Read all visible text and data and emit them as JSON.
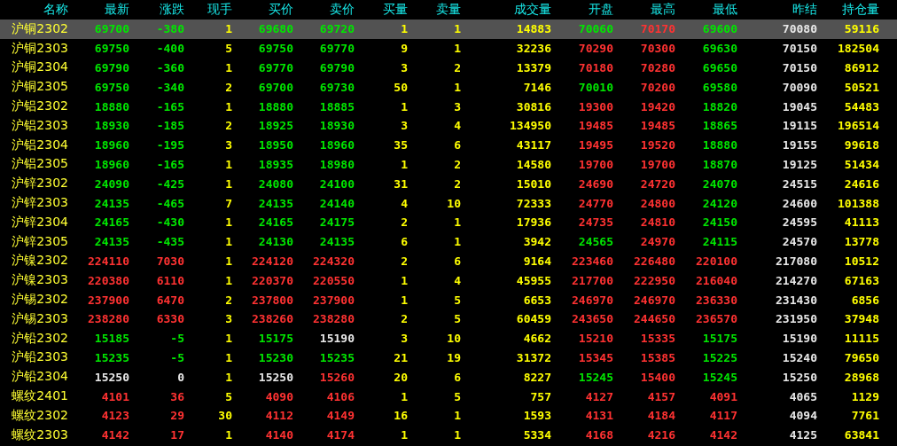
{
  "columns": [
    "名称",
    "最新",
    "涨跌",
    "现手",
    "买价",
    "卖价",
    "买量",
    "卖量",
    "成交量",
    "开盘",
    "最高",
    "最低",
    "昨结",
    "持仓量"
  ],
  "rows": [
    {
      "name": "沪铜2302",
      "selected": true,
      "last": {
        "text": "69700",
        "color": "#00e600"
      },
      "change": {
        "text": "-380",
        "color": "#00e600"
      },
      "lot": "1",
      "bid": {
        "text": "69680",
        "color": "#00e600"
      },
      "ask": {
        "text": "69720",
        "color": "#00e600"
      },
      "bid_qty": "1",
      "ask_qty": "1",
      "volume": "14883",
      "open": {
        "text": "70060",
        "color": "#00e600"
      },
      "high": {
        "text": "70170",
        "color": "#ff3232"
      },
      "low": {
        "text": "69600",
        "color": "#00e600"
      },
      "prev_settle": "70080",
      "open_interest": "59116"
    },
    {
      "name": "沪铜2303",
      "selected": false,
      "last": {
        "text": "69750",
        "color": "#00e600"
      },
      "change": {
        "text": "-400",
        "color": "#00e600"
      },
      "lot": "5",
      "bid": {
        "text": "69750",
        "color": "#00e600"
      },
      "ask": {
        "text": "69770",
        "color": "#00e600"
      },
      "bid_qty": "9",
      "ask_qty": "1",
      "volume": "32236",
      "open": {
        "text": "70290",
        "color": "#ff3232"
      },
      "high": {
        "text": "70300",
        "color": "#ff3232"
      },
      "low": {
        "text": "69630",
        "color": "#00e600"
      },
      "prev_settle": "70150",
      "open_interest": "182504"
    },
    {
      "name": "沪铜2304",
      "selected": false,
      "last": {
        "text": "69790",
        "color": "#00e600"
      },
      "change": {
        "text": "-360",
        "color": "#00e600"
      },
      "lot": "1",
      "bid": {
        "text": "69770",
        "color": "#00e600"
      },
      "ask": {
        "text": "69790",
        "color": "#00e600"
      },
      "bid_qty": "3",
      "ask_qty": "2",
      "volume": "13379",
      "open": {
        "text": "70180",
        "color": "#ff3232"
      },
      "high": {
        "text": "70280",
        "color": "#ff3232"
      },
      "low": {
        "text": "69650",
        "color": "#00e600"
      },
      "prev_settle": "70150",
      "open_interest": "86912"
    },
    {
      "name": "沪铜2305",
      "selected": false,
      "last": {
        "text": "69750",
        "color": "#00e600"
      },
      "change": {
        "text": "-340",
        "color": "#00e600"
      },
      "lot": "2",
      "bid": {
        "text": "69700",
        "color": "#00e600"
      },
      "ask": {
        "text": "69730",
        "color": "#00e600"
      },
      "bid_qty": "50",
      "ask_qty": "1",
      "volume": "7146",
      "open": {
        "text": "70010",
        "color": "#00e600"
      },
      "high": {
        "text": "70200",
        "color": "#ff3232"
      },
      "low": {
        "text": "69580",
        "color": "#00e600"
      },
      "prev_settle": "70090",
      "open_interest": "50521"
    },
    {
      "name": "沪铝2302",
      "selected": false,
      "last": {
        "text": "18880",
        "color": "#00e600"
      },
      "change": {
        "text": "-165",
        "color": "#00e600"
      },
      "lot": "1",
      "bid": {
        "text": "18880",
        "color": "#00e600"
      },
      "ask": {
        "text": "18885",
        "color": "#00e600"
      },
      "bid_qty": "1",
      "ask_qty": "3",
      "volume": "30816",
      "open": {
        "text": "19300",
        "color": "#ff3232"
      },
      "high": {
        "text": "19420",
        "color": "#ff3232"
      },
      "low": {
        "text": "18820",
        "color": "#00e600"
      },
      "prev_settle": "19045",
      "open_interest": "54483"
    },
    {
      "name": "沪铝2303",
      "selected": false,
      "last": {
        "text": "18930",
        "color": "#00e600"
      },
      "change": {
        "text": "-185",
        "color": "#00e600"
      },
      "lot": "2",
      "bid": {
        "text": "18925",
        "color": "#00e600"
      },
      "ask": {
        "text": "18930",
        "color": "#00e600"
      },
      "bid_qty": "3",
      "ask_qty": "4",
      "volume": "134950",
      "open": {
        "text": "19485",
        "color": "#ff3232"
      },
      "high": {
        "text": "19485",
        "color": "#ff3232"
      },
      "low": {
        "text": "18865",
        "color": "#00e600"
      },
      "prev_settle": "19115",
      "open_interest": "196514"
    },
    {
      "name": "沪铝2304",
      "selected": false,
      "last": {
        "text": "18960",
        "color": "#00e600"
      },
      "change": {
        "text": "-195",
        "color": "#00e600"
      },
      "lot": "3",
      "bid": {
        "text": "18950",
        "color": "#00e600"
      },
      "ask": {
        "text": "18960",
        "color": "#00e600"
      },
      "bid_qty": "35",
      "ask_qty": "6",
      "volume": "43117",
      "open": {
        "text": "19495",
        "color": "#ff3232"
      },
      "high": {
        "text": "19520",
        "color": "#ff3232"
      },
      "low": {
        "text": "18880",
        "color": "#00e600"
      },
      "prev_settle": "19155",
      "open_interest": "99618"
    },
    {
      "name": "沪铝2305",
      "selected": false,
      "last": {
        "text": "18960",
        "color": "#00e600"
      },
      "change": {
        "text": "-165",
        "color": "#00e600"
      },
      "lot": "1",
      "bid": {
        "text": "18935",
        "color": "#00e600"
      },
      "ask": {
        "text": "18980",
        "color": "#00e600"
      },
      "bid_qty": "1",
      "ask_qty": "2",
      "volume": "14580",
      "open": {
        "text": "19700",
        "color": "#ff3232"
      },
      "high": {
        "text": "19700",
        "color": "#ff3232"
      },
      "low": {
        "text": "18870",
        "color": "#00e600"
      },
      "prev_settle": "19125",
      "open_interest": "51434"
    },
    {
      "name": "沪锌2302",
      "selected": false,
      "last": {
        "text": "24090",
        "color": "#00e600"
      },
      "change": {
        "text": "-425",
        "color": "#00e600"
      },
      "lot": "1",
      "bid": {
        "text": "24080",
        "color": "#00e600"
      },
      "ask": {
        "text": "24100",
        "color": "#00e600"
      },
      "bid_qty": "31",
      "ask_qty": "2",
      "volume": "15010",
      "open": {
        "text": "24690",
        "color": "#ff3232"
      },
      "high": {
        "text": "24720",
        "color": "#ff3232"
      },
      "low": {
        "text": "24070",
        "color": "#00e600"
      },
      "prev_settle": "24515",
      "open_interest": "24616"
    },
    {
      "name": "沪锌2303",
      "selected": false,
      "last": {
        "text": "24135",
        "color": "#00e600"
      },
      "change": {
        "text": "-465",
        "color": "#00e600"
      },
      "lot": "7",
      "bid": {
        "text": "24135",
        "color": "#00e600"
      },
      "ask": {
        "text": "24140",
        "color": "#00e600"
      },
      "bid_qty": "4",
      "ask_qty": "10",
      "volume": "72333",
      "open": {
        "text": "24770",
        "color": "#ff3232"
      },
      "high": {
        "text": "24800",
        "color": "#ff3232"
      },
      "low": {
        "text": "24120",
        "color": "#00e600"
      },
      "prev_settle": "24600",
      "open_interest": "101388"
    },
    {
      "name": "沪锌2304",
      "selected": false,
      "last": {
        "text": "24165",
        "color": "#00e600"
      },
      "change": {
        "text": "-430",
        "color": "#00e600"
      },
      "lot": "1",
      "bid": {
        "text": "24165",
        "color": "#00e600"
      },
      "ask": {
        "text": "24175",
        "color": "#00e600"
      },
      "bid_qty": "2",
      "ask_qty": "1",
      "volume": "17936",
      "open": {
        "text": "24735",
        "color": "#ff3232"
      },
      "high": {
        "text": "24810",
        "color": "#ff3232"
      },
      "low": {
        "text": "24150",
        "color": "#00e600"
      },
      "prev_settle": "24595",
      "open_interest": "41113"
    },
    {
      "name": "沪锌2305",
      "selected": false,
      "last": {
        "text": "24135",
        "color": "#00e600"
      },
      "change": {
        "text": "-435",
        "color": "#00e600"
      },
      "lot": "1",
      "bid": {
        "text": "24130",
        "color": "#00e600"
      },
      "ask": {
        "text": "24135",
        "color": "#00e600"
      },
      "bid_qty": "6",
      "ask_qty": "1",
      "volume": "3942",
      "open": {
        "text": "24565",
        "color": "#00e600"
      },
      "high": {
        "text": "24970",
        "color": "#ff3232"
      },
      "low": {
        "text": "24115",
        "color": "#00e600"
      },
      "prev_settle": "24570",
      "open_interest": "13778"
    },
    {
      "name": "沪镍2302",
      "selected": false,
      "last": {
        "text": "224110",
        "color": "#ff3232"
      },
      "change": {
        "text": "7030",
        "color": "#ff3232"
      },
      "lot": "1",
      "bid": {
        "text": "224120",
        "color": "#ff3232"
      },
      "ask": {
        "text": "224320",
        "color": "#ff3232"
      },
      "bid_qty": "2",
      "ask_qty": "6",
      "volume": "9164",
      "open": {
        "text": "223460",
        "color": "#ff3232"
      },
      "high": {
        "text": "226480",
        "color": "#ff3232"
      },
      "low": {
        "text": "220100",
        "color": "#ff3232"
      },
      "prev_settle": "217080",
      "open_interest": "10512"
    },
    {
      "name": "沪镍2303",
      "selected": false,
      "last": {
        "text": "220380",
        "color": "#ff3232"
      },
      "change": {
        "text": "6110",
        "color": "#ff3232"
      },
      "lot": "1",
      "bid": {
        "text": "220370",
        "color": "#ff3232"
      },
      "ask": {
        "text": "220550",
        "color": "#ff3232"
      },
      "bid_qty": "1",
      "ask_qty": "4",
      "volume": "45955",
      "open": {
        "text": "217700",
        "color": "#ff3232"
      },
      "high": {
        "text": "222950",
        "color": "#ff3232"
      },
      "low": {
        "text": "216040",
        "color": "#ff3232"
      },
      "prev_settle": "214270",
      "open_interest": "67163"
    },
    {
      "name": "沪锡2302",
      "selected": false,
      "last": {
        "text": "237900",
        "color": "#ff3232"
      },
      "change": {
        "text": "6470",
        "color": "#ff3232"
      },
      "lot": "2",
      "bid": {
        "text": "237800",
        "color": "#ff3232"
      },
      "ask": {
        "text": "237900",
        "color": "#ff3232"
      },
      "bid_qty": "1",
      "ask_qty": "5",
      "volume": "6653",
      "open": {
        "text": "246970",
        "color": "#ff3232"
      },
      "high": {
        "text": "246970",
        "color": "#ff3232"
      },
      "low": {
        "text": "236330",
        "color": "#ff3232"
      },
      "prev_settle": "231430",
      "open_interest": "6856"
    },
    {
      "name": "沪锡2303",
      "selected": false,
      "last": {
        "text": "238280",
        "color": "#ff3232"
      },
      "change": {
        "text": "6330",
        "color": "#ff3232"
      },
      "lot": "3",
      "bid": {
        "text": "238260",
        "color": "#ff3232"
      },
      "ask": {
        "text": "238280",
        "color": "#ff3232"
      },
      "bid_qty": "2",
      "ask_qty": "5",
      "volume": "60459",
      "open": {
        "text": "243650",
        "color": "#ff3232"
      },
      "high": {
        "text": "244650",
        "color": "#ff3232"
      },
      "low": {
        "text": "236570",
        "color": "#ff3232"
      },
      "prev_settle": "231950",
      "open_interest": "37948"
    },
    {
      "name": "沪铅2302",
      "selected": false,
      "last": {
        "text": "15185",
        "color": "#00e600"
      },
      "change": {
        "text": "-5",
        "color": "#00e600"
      },
      "lot": "1",
      "bid": {
        "text": "15175",
        "color": "#00e600"
      },
      "ask": {
        "text": "15190",
        "color": "#e8e8e8"
      },
      "bid_qty": "3",
      "ask_qty": "10",
      "volume": "4662",
      "open": {
        "text": "15210",
        "color": "#ff3232"
      },
      "high": {
        "text": "15335",
        "color": "#ff3232"
      },
      "low": {
        "text": "15175",
        "color": "#00e600"
      },
      "prev_settle": "15190",
      "open_interest": "11115"
    },
    {
      "name": "沪铅2303",
      "selected": false,
      "last": {
        "text": "15235",
        "color": "#00e600"
      },
      "change": {
        "text": "-5",
        "color": "#00e600"
      },
      "lot": "1",
      "bid": {
        "text": "15230",
        "color": "#00e600"
      },
      "ask": {
        "text": "15235",
        "color": "#00e600"
      },
      "bid_qty": "21",
      "ask_qty": "19",
      "volume": "31372",
      "open": {
        "text": "15345",
        "color": "#ff3232"
      },
      "high": {
        "text": "15385",
        "color": "#ff3232"
      },
      "low": {
        "text": "15225",
        "color": "#00e600"
      },
      "prev_settle": "15240",
      "open_interest": "79650"
    },
    {
      "name": "沪铅2304",
      "selected": false,
      "last": {
        "text": "15250",
        "color": "#e8e8e8"
      },
      "change": {
        "text": "0",
        "color": "#e8e8e8"
      },
      "lot": "1",
      "bid": {
        "text": "15250",
        "color": "#e8e8e8"
      },
      "ask": {
        "text": "15260",
        "color": "#ff3232"
      },
      "bid_qty": "20",
      "ask_qty": "6",
      "volume": "8227",
      "open": {
        "text": "15245",
        "color": "#00e600"
      },
      "high": {
        "text": "15400",
        "color": "#ff3232"
      },
      "low": {
        "text": "15245",
        "color": "#00e600"
      },
      "prev_settle": "15250",
      "open_interest": "28968"
    },
    {
      "name": "螺纹2401",
      "selected": false,
      "last": {
        "text": "4101",
        "color": "#ff3232"
      },
      "change": {
        "text": "36",
        "color": "#ff3232"
      },
      "lot": "5",
      "bid": {
        "text": "4090",
        "color": "#ff3232"
      },
      "ask": {
        "text": "4106",
        "color": "#ff3232"
      },
      "bid_qty": "1",
      "ask_qty": "5",
      "volume": "757",
      "open": {
        "text": "4127",
        "color": "#ff3232"
      },
      "high": {
        "text": "4157",
        "color": "#ff3232"
      },
      "low": {
        "text": "4091",
        "color": "#ff3232"
      },
      "prev_settle": "4065",
      "open_interest": "1129"
    },
    {
      "name": "螺纹2302",
      "selected": false,
      "last": {
        "text": "4123",
        "color": "#ff3232"
      },
      "change": {
        "text": "29",
        "color": "#ff3232"
      },
      "lot": "30",
      "bid": {
        "text": "4112",
        "color": "#ff3232"
      },
      "ask": {
        "text": "4149",
        "color": "#ff3232"
      },
      "bid_qty": "16",
      "ask_qty": "1",
      "volume": "1593",
      "open": {
        "text": "4131",
        "color": "#ff3232"
      },
      "high": {
        "text": "4184",
        "color": "#ff3232"
      },
      "low": {
        "text": "4117",
        "color": "#ff3232"
      },
      "prev_settle": "4094",
      "open_interest": "7761"
    },
    {
      "name": "螺纹2303",
      "selected": false,
      "last": {
        "text": "4142",
        "color": "#ff3232"
      },
      "change": {
        "text": "17",
        "color": "#ff3232"
      },
      "lot": "1",
      "bid": {
        "text": "4140",
        "color": "#ff3232"
      },
      "ask": {
        "text": "4174",
        "color": "#ff3232"
      },
      "bid_qty": "1",
      "ask_qty": "1",
      "volume": "5334",
      "open": {
        "text": "4168",
        "color": "#ff3232"
      },
      "high": {
        "text": "4216",
        "color": "#ff3232"
      },
      "low": {
        "text": "4142",
        "color": "#ff3232"
      },
      "prev_settle": "4125",
      "open_interest": "63841"
    }
  ]
}
